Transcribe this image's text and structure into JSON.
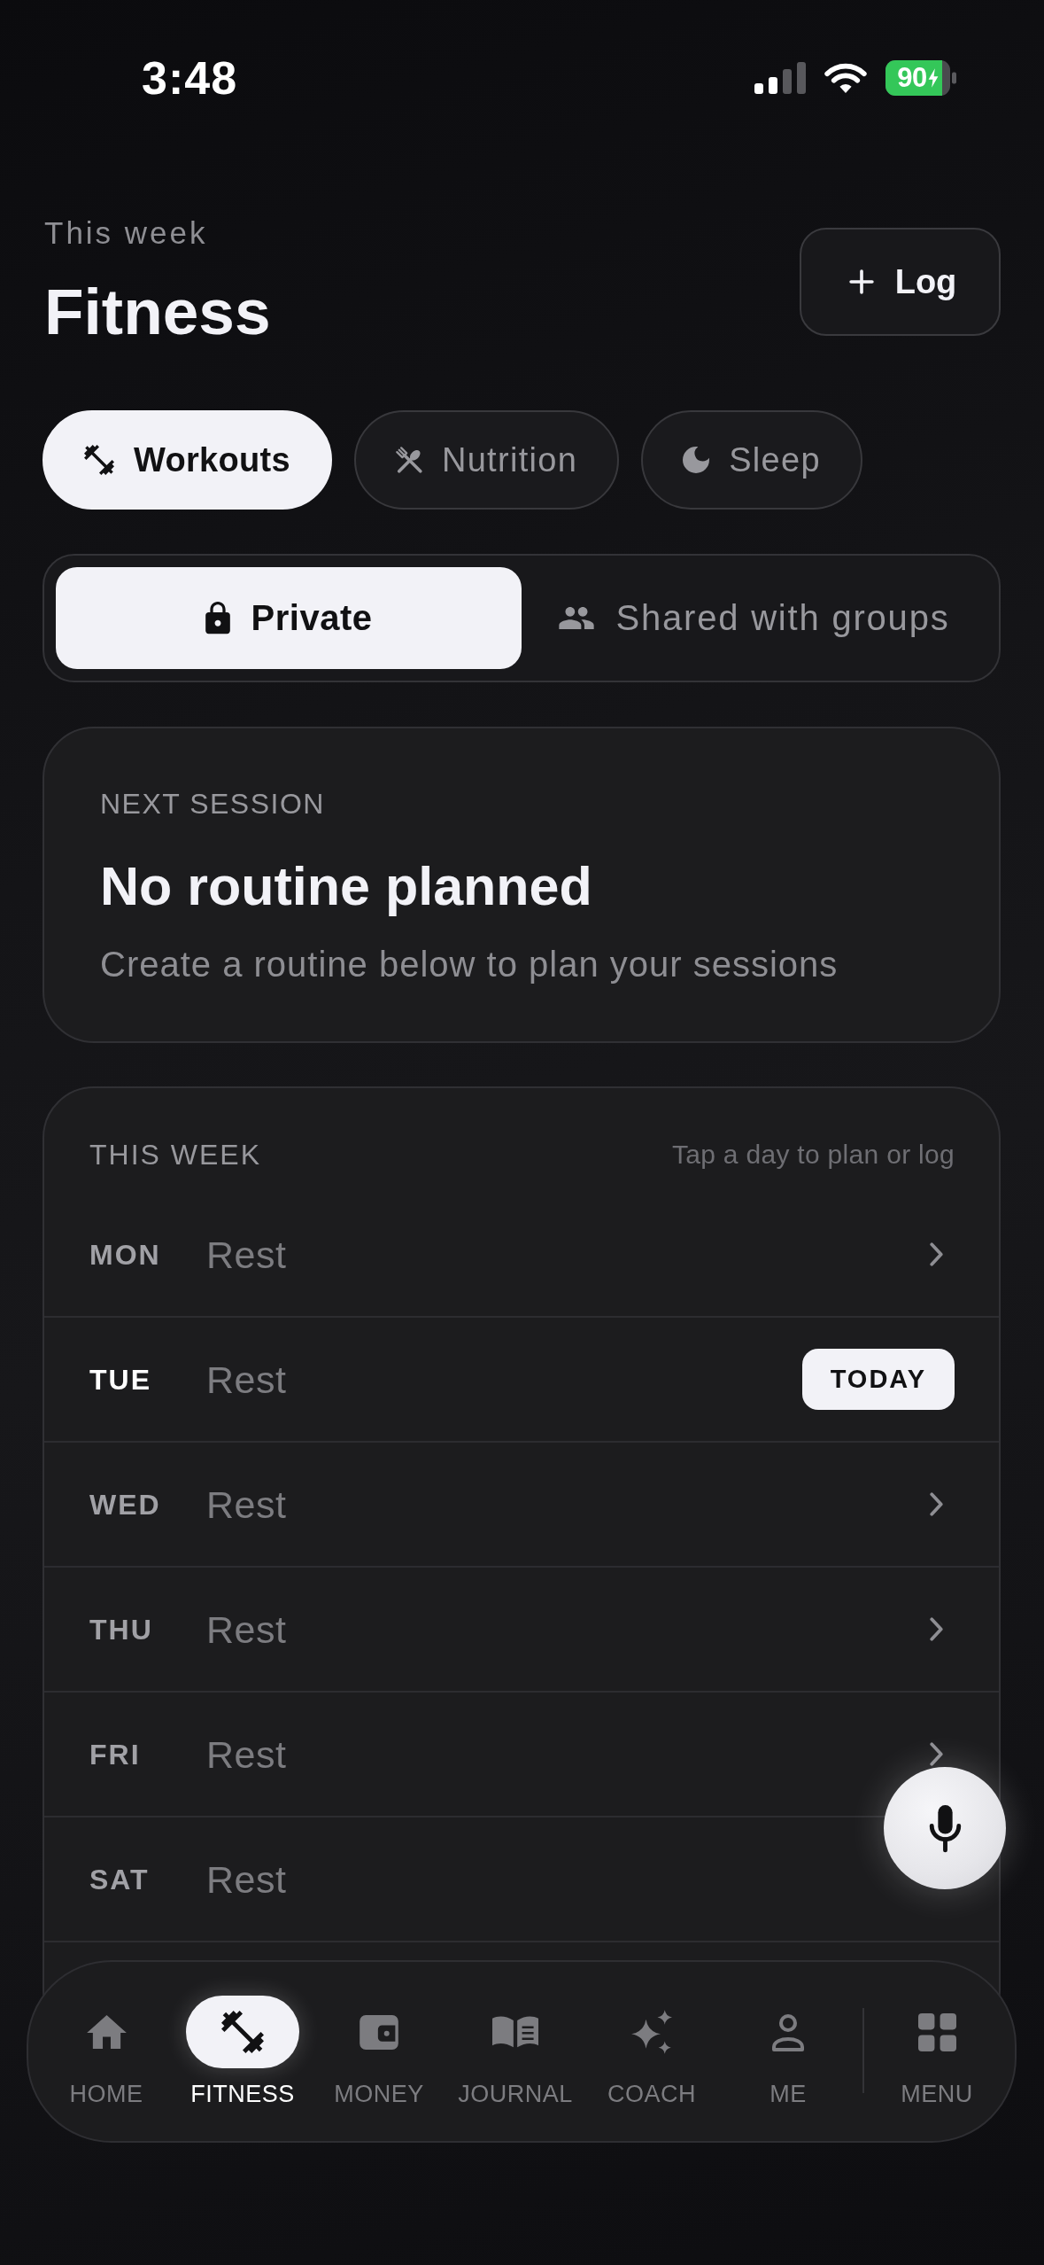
{
  "status_bar": {
    "time": "3:48",
    "battery": "90",
    "charging": true
  },
  "header": {
    "caption": "This week",
    "title": "Fitness",
    "log_button": "Log"
  },
  "category_tabs": [
    {
      "label": "Workouts",
      "selected": true
    },
    {
      "label": "Nutrition",
      "selected": false
    },
    {
      "label": "Sleep",
      "selected": false
    }
  ],
  "visibility_toggle": [
    {
      "label": "Private",
      "selected": true
    },
    {
      "label": "Shared with groups",
      "selected": false
    }
  ],
  "next_session": {
    "label": "NEXT SESSION",
    "title": "No routine planned",
    "description": "Create a routine below to plan your sessions"
  },
  "this_week": {
    "title": "THIS WEEK",
    "hint": "Tap a day to plan or log",
    "today_badge": "TODAY",
    "days": [
      {
        "day": "MON",
        "plan": "Rest",
        "today": false,
        "chevron": true
      },
      {
        "day": "TUE",
        "plan": "Rest",
        "today": true,
        "chevron": false
      },
      {
        "day": "WED",
        "plan": "Rest",
        "today": false,
        "chevron": true
      },
      {
        "day": "THU",
        "plan": "Rest",
        "today": false,
        "chevron": true
      },
      {
        "day": "FRI",
        "plan": "Rest",
        "today": false,
        "chevron": true
      },
      {
        "day": "SAT",
        "plan": "Rest",
        "today": false,
        "chevron": false
      }
    ]
  },
  "bottom_nav": {
    "items": [
      {
        "label": "HOME",
        "selected": false
      },
      {
        "label": "FITNESS",
        "selected": true
      },
      {
        "label": "MONEY",
        "selected": false
      },
      {
        "label": "JOURNAL",
        "selected": false
      },
      {
        "label": "COACH",
        "selected": false
      },
      {
        "label": "ME",
        "selected": false
      }
    ],
    "menu": {
      "label": "MENU"
    }
  }
}
